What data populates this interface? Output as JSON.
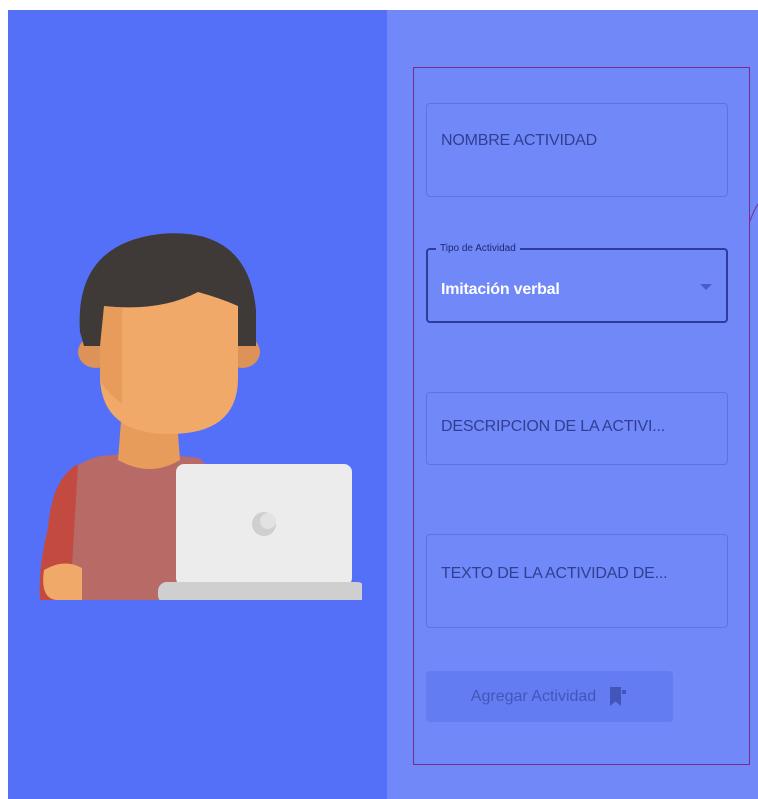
{
  "form": {
    "name_field": {
      "placeholder": "NOMBRE ACTIVIDAD"
    },
    "activity_type": {
      "label": "Tipo de Actividad",
      "selected": "Imitación verbal"
    },
    "description_field": {
      "placeholder": "DESCRIPCION DE LA ACTIVI..."
    },
    "text_field": {
      "placeholder": "TEXTO DE LA ACTIVIDAD DE..."
    },
    "submit_label": "Agregar Actividad",
    "submit_icon": "bookmark-add-icon"
  },
  "illustration": {
    "name": "person-with-laptop",
    "colors": {
      "hair": "#3f3a37",
      "skin": "#f0a968",
      "skin_shadow": "#dd9258",
      "shirt": "#b86a67",
      "shirt_dark": "#c24a40",
      "laptop": "#ececec",
      "laptop_base": "#cfcfcf"
    }
  },
  "colors": {
    "left_panel": "#5470f8",
    "right_panel": "#7088f8",
    "card_border": "#7a2a8a",
    "select_border": "#2c3d9e"
  }
}
